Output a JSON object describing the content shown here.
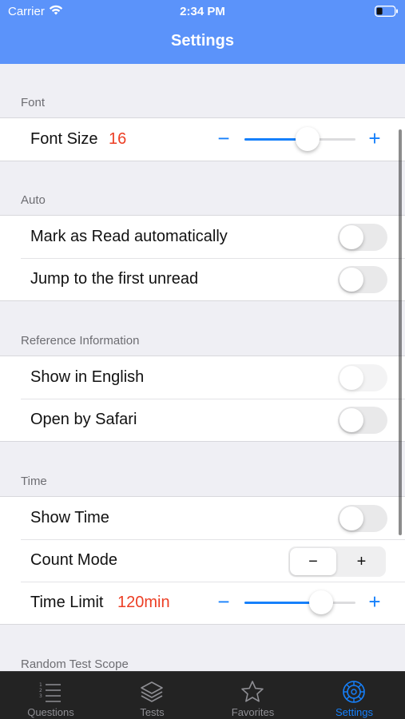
{
  "status_bar": {
    "carrier": "Carrier",
    "time": "2:34 PM",
    "wifi_icon": "wifi-icon",
    "battery_icon": "battery-low-icon"
  },
  "nav": {
    "title": "Settings"
  },
  "sections": {
    "font": {
      "header": "Font",
      "font_size": {
        "label": "Font Size",
        "value": "16",
        "slider_fraction": 0.57
      }
    },
    "auto": {
      "header": "Auto",
      "mark_read": {
        "label": "Mark as Read automatically",
        "on": false
      },
      "jump_unread": {
        "label": "Jump to the first unread",
        "on": false
      }
    },
    "reference": {
      "header": "Reference Information",
      "show_english": {
        "label": "Show in English",
        "on": false,
        "enabled": false
      },
      "open_safari": {
        "label": "Open by Safari",
        "on": false
      }
    },
    "time": {
      "header": "Time",
      "show_time": {
        "label": "Show Time",
        "on": false
      },
      "count_mode": {
        "label": "Count Mode",
        "minus": "−",
        "plus": "+"
      },
      "time_limit": {
        "label": "Time Limit",
        "value": "120min",
        "slider_fraction": 0.69
      }
    },
    "random": {
      "header": "Random Test Scope"
    }
  },
  "slider_controls": {
    "minus": "−",
    "plus": "+"
  },
  "tabs": [
    {
      "label": "Questions",
      "icon": "numbered-list-icon",
      "active": false
    },
    {
      "label": "Tests",
      "icon": "stacked-layers-icon",
      "active": false
    },
    {
      "label": "Favorites",
      "icon": "star-icon",
      "active": false
    },
    {
      "label": "Settings",
      "icon": "gear-icon",
      "active": true
    }
  ],
  "colors": {
    "accent": "#1680fb",
    "header": "#5b93fa",
    "value_red": "#ec3e24",
    "tabbar": "#232323"
  }
}
